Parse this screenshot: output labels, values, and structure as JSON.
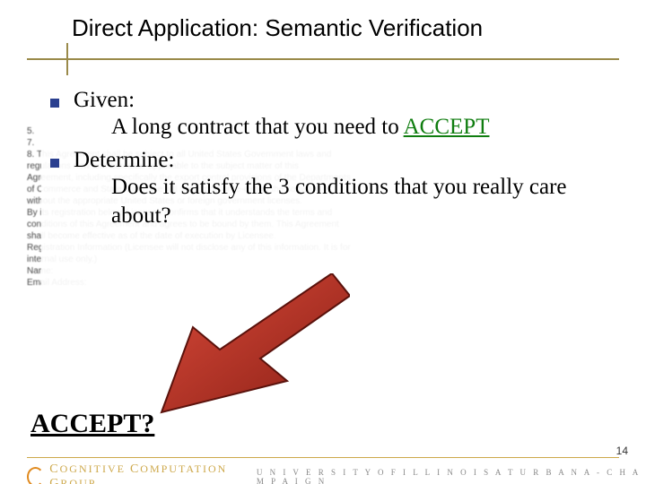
{
  "title": "Direct Application: Semantic Verification",
  "bullets": {
    "given_label": "Given:",
    "given_sub_prefix": "A long contract that you need to ",
    "given_sub_accept": "ACCEPT",
    "determine_label": "Determine:",
    "determine_sub": "Does it satisfy the 3 conditions that you really care about?"
  },
  "accept_q": "ACCEPT?",
  "contract_lines": [
    "5.",
    "",
    "",
    "7.",
    "8.  This Agreement shall be subject to all United States Government laws and",
    "    regulations now and hereafter applicable to the subject matter of this",
    "    Agreement, including specifically the export control provisions of the Departments",
    "    of Commerce and State. Licensee will not export or re-export the software",
    "    without the appropriate United States or foreign government licenses.",
    "By its registration below, Licensee confirms that it understands the terms and",
    "conditions of this Agreement and agrees to be bound by them. This Agreement",
    "shall become effective as of the date of execution by Licensee.",
    "Registration Information (Licensee will not disclose any of this information. It is for",
    "internal use only.)",
    "Name:",
    "Email Address:"
  ],
  "footer": {
    "group": "COGNITIVE COMPUTATION GROUP",
    "uni": "UNIVERSITY OF ILLINOIS AT URBANA-CHAMPAIGN"
  },
  "page_number": "14"
}
